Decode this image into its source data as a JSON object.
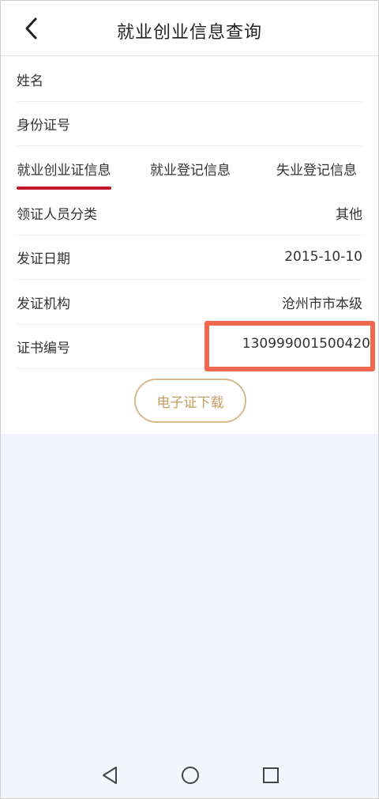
{
  "header": {
    "title": "就业创业信息查询",
    "back_icon": "chevron-left-icon"
  },
  "fields_top": [
    {
      "label": "姓名",
      "value": ""
    },
    {
      "label": "身份证号",
      "value": ""
    }
  ],
  "tabs": [
    {
      "label": "就业创业证信息",
      "active": true
    },
    {
      "label": "就业登记信息",
      "active": false
    },
    {
      "label": "失业登记信息",
      "active": false
    }
  ],
  "details": [
    {
      "label": "领证人员分类",
      "value": "其他"
    },
    {
      "label": "发证日期",
      "value": "2015-10-10"
    },
    {
      "label": "发证机构",
      "value": "沧州市市本级"
    },
    {
      "label": "证书编号",
      "value": "130999001500420"
    }
  ],
  "download_button": "电子证下载",
  "colors": {
    "accent_red": "#c4162a",
    "button_gold": "#c59b5d",
    "highlight": "#f0684f"
  },
  "navbar": {
    "back_icon": "triangle-back-icon",
    "home_icon": "circle-home-icon",
    "recents_icon": "square-recents-icon"
  }
}
